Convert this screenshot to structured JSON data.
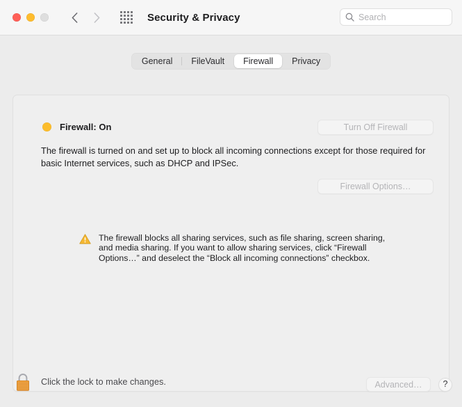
{
  "window": {
    "title": "Security & Privacy",
    "traffic_lights": {
      "close": "close-button",
      "minimize": "minimize-button",
      "zoom": "zoom-button"
    },
    "nav": {
      "back_icon": "chevron-left-icon",
      "forward_icon": "chevron-right-icon",
      "grid_icon": "grid-view-icon"
    },
    "colors": {
      "close": "#ff5f57",
      "minimize": "#febc2e",
      "zoom": "#dedede",
      "status_dot": "#fcbd2c",
      "warning": "#f5b731",
      "lock": "#f0a23c",
      "panel_bg": "#efefef",
      "window_bg": "#ececec",
      "titlebar_bg": "#f6f6f6"
    }
  },
  "search": {
    "placeholder": "Search",
    "value": "",
    "icon": "search-icon"
  },
  "tabs": [
    {
      "label": "General",
      "active": false
    },
    {
      "label": "FileVault",
      "active": false
    },
    {
      "label": "Firewall",
      "active": true
    },
    {
      "label": "Privacy",
      "active": false
    }
  ],
  "main": {
    "status": {
      "label": "Firewall: On",
      "dot_name": "status-dot-on"
    },
    "turn_off_button": {
      "label": "Turn Off Firewall",
      "disabled": true
    },
    "description": "The firewall is turned on and set up to block all incoming connections except for those required for basic Internet services, such as DHCP and IPSec.",
    "options_button": {
      "label": "Firewall Options…",
      "disabled": true
    },
    "warning": {
      "icon": "warning-triangle-icon",
      "text": "The firewall blocks all sharing services, such as file sharing, screen sharing, and media sharing. If you want to allow sharing services, click “Firewall Options…” and deselect the “Block all incoming connections” checkbox."
    }
  },
  "bottom": {
    "lock": {
      "icon": "lock-closed-icon",
      "label": "Click the lock to make changes."
    },
    "advanced_button": {
      "label": "Advanced…",
      "disabled": true
    },
    "help_button": {
      "label": "?"
    }
  }
}
